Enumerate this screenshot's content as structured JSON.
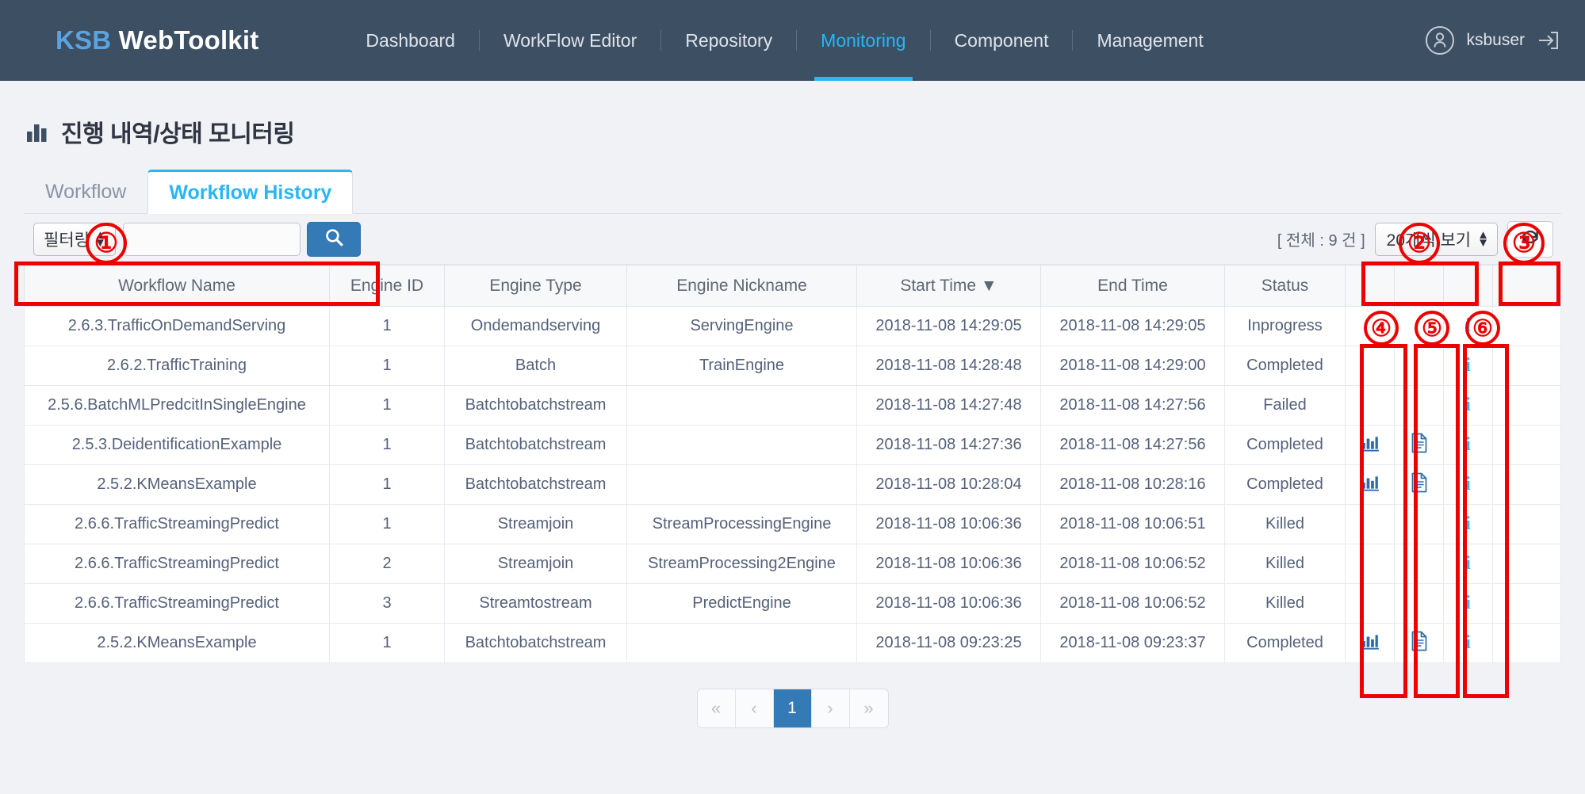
{
  "navbar": {
    "brand_prefix": "KSB",
    "brand_suffix": "WebToolkit",
    "links": [
      {
        "label": "Dashboard",
        "active": false
      },
      {
        "label": "WorkFlow Editor",
        "active": false
      },
      {
        "label": "Repository",
        "active": false
      },
      {
        "label": "Monitoring",
        "active": true
      },
      {
        "label": "Component",
        "active": false
      },
      {
        "label": "Management",
        "active": false
      }
    ],
    "username": "ksbuser",
    "user_icon": "user-circle-icon",
    "logout_icon": "logout-icon",
    "active_color": "#29b6f6",
    "background": "#3d4f63"
  },
  "page": {
    "title": "진행 내역/상태 모니터링",
    "title_icon": "bar-chart-icon"
  },
  "tabs": [
    {
      "label": "Workflow",
      "active": false
    },
    {
      "label": "Workflow History",
      "active": true
    }
  ],
  "toolbar": {
    "filter_label": "필터링",
    "search_value": "",
    "search_placeholder": "",
    "search_icon": "search-icon",
    "total_count_text": "[ 전체 : 9 건 ]",
    "page_size_label": "20개씩 보기",
    "refresh_icon": "refresh-icon"
  },
  "table": {
    "headers": [
      "Workflow Name",
      "Engine ID",
      "Engine Type",
      "Engine Nickname",
      "Start Time ▼",
      "End Time",
      "Status"
    ],
    "sorted_column": "Start Time",
    "sort_direction": "desc",
    "rows": [
      {
        "workflow_name": "2.6.3.TrafficOnDemandServing",
        "engine_id": "1",
        "engine_type": "Ondemandserving",
        "engine_nickname": "ServingEngine",
        "start_time": "2018-11-08 14:29:05",
        "end_time": "2018-11-08 14:29:05",
        "status": "Inprogress",
        "status_class": "st-inprogress",
        "has_chart": false,
        "has_report": false,
        "has_info": true
      },
      {
        "workflow_name": "2.6.2.TrafficTraining",
        "engine_id": "1",
        "engine_type": "Batch",
        "engine_nickname": "TrainEngine",
        "start_time": "2018-11-08 14:28:48",
        "end_time": "2018-11-08 14:29:00",
        "status": "Completed",
        "status_class": "st-completed",
        "has_chart": false,
        "has_report": false,
        "has_info": true
      },
      {
        "workflow_name": "2.5.6.BatchMLPredcitInSingleEngine",
        "engine_id": "1",
        "engine_type": "Batchtobatchstream",
        "engine_nickname": "",
        "start_time": "2018-11-08 14:27:48",
        "end_time": "2018-11-08 14:27:56",
        "status": "Failed",
        "status_class": "st-failed",
        "has_chart": false,
        "has_report": false,
        "has_info": true
      },
      {
        "workflow_name": "2.5.3.DeidentificationExample",
        "engine_id": "1",
        "engine_type": "Batchtobatchstream",
        "engine_nickname": "",
        "start_time": "2018-11-08 14:27:36",
        "end_time": "2018-11-08 14:27:56",
        "status": "Completed",
        "status_class": "st-completed",
        "has_chart": true,
        "has_report": true,
        "has_info": true
      },
      {
        "workflow_name": "2.5.2.KMeansExample",
        "engine_id": "1",
        "engine_type": "Batchtobatchstream",
        "engine_nickname": "",
        "start_time": "2018-11-08 10:28:04",
        "end_time": "2018-11-08 10:28:16",
        "status": "Completed",
        "status_class": "st-completed",
        "has_chart": true,
        "has_report": true,
        "has_info": true
      },
      {
        "workflow_name": "2.6.6.TrafficStreamingPredict",
        "engine_id": "1",
        "engine_type": "Streamjoin",
        "engine_nickname": "StreamProcessingEngine",
        "start_time": "2018-11-08 10:06:36",
        "end_time": "2018-11-08 10:06:51",
        "status": "Killed",
        "status_class": "st-killed",
        "has_chart": false,
        "has_report": false,
        "has_info": true
      },
      {
        "workflow_name": "2.6.6.TrafficStreamingPredict",
        "engine_id": "2",
        "engine_type": "Streamjoin",
        "engine_nickname": "StreamProcessing2Engine",
        "start_time": "2018-11-08 10:06:36",
        "end_time": "2018-11-08 10:06:52",
        "status": "Killed",
        "status_class": "st-killed",
        "has_chart": false,
        "has_report": false,
        "has_info": true
      },
      {
        "workflow_name": "2.6.6.TrafficStreamingPredict",
        "engine_id": "3",
        "engine_type": "Streamtostream",
        "engine_nickname": "PredictEngine",
        "start_time": "2018-11-08 10:06:36",
        "end_time": "2018-11-08 10:06:52",
        "status": "Killed",
        "status_class": "st-killed",
        "has_chart": false,
        "has_report": false,
        "has_info": true
      },
      {
        "workflow_name": "2.5.2.KMeansExample",
        "engine_id": "1",
        "engine_type": "Batchtobatchstream",
        "engine_nickname": "",
        "start_time": "2018-11-08 09:23:25",
        "end_time": "2018-11-08 09:23:37",
        "status": "Completed",
        "status_class": "st-completed",
        "has_chart": true,
        "has_report": true,
        "has_info": true
      }
    ],
    "action_icons": {
      "chart": "bar-chart-icon",
      "report": "document-icon",
      "info": "info-icon"
    }
  },
  "pagination": {
    "first_label": "«",
    "prev_label": "‹",
    "pages": [
      "1"
    ],
    "current_page": "1",
    "next_label": "›",
    "last_label": "»"
  },
  "annotations": {
    "color": "#ee0000",
    "markers": [
      {
        "number": "①",
        "target": "filter-search-area"
      },
      {
        "number": "②",
        "target": "page-size-select"
      },
      {
        "number": "③",
        "target": "refresh-button"
      },
      {
        "number": "④",
        "target": "chart-action-column"
      },
      {
        "number": "⑤",
        "target": "report-action-column"
      },
      {
        "number": "⑥",
        "target": "info-action-column"
      }
    ]
  }
}
